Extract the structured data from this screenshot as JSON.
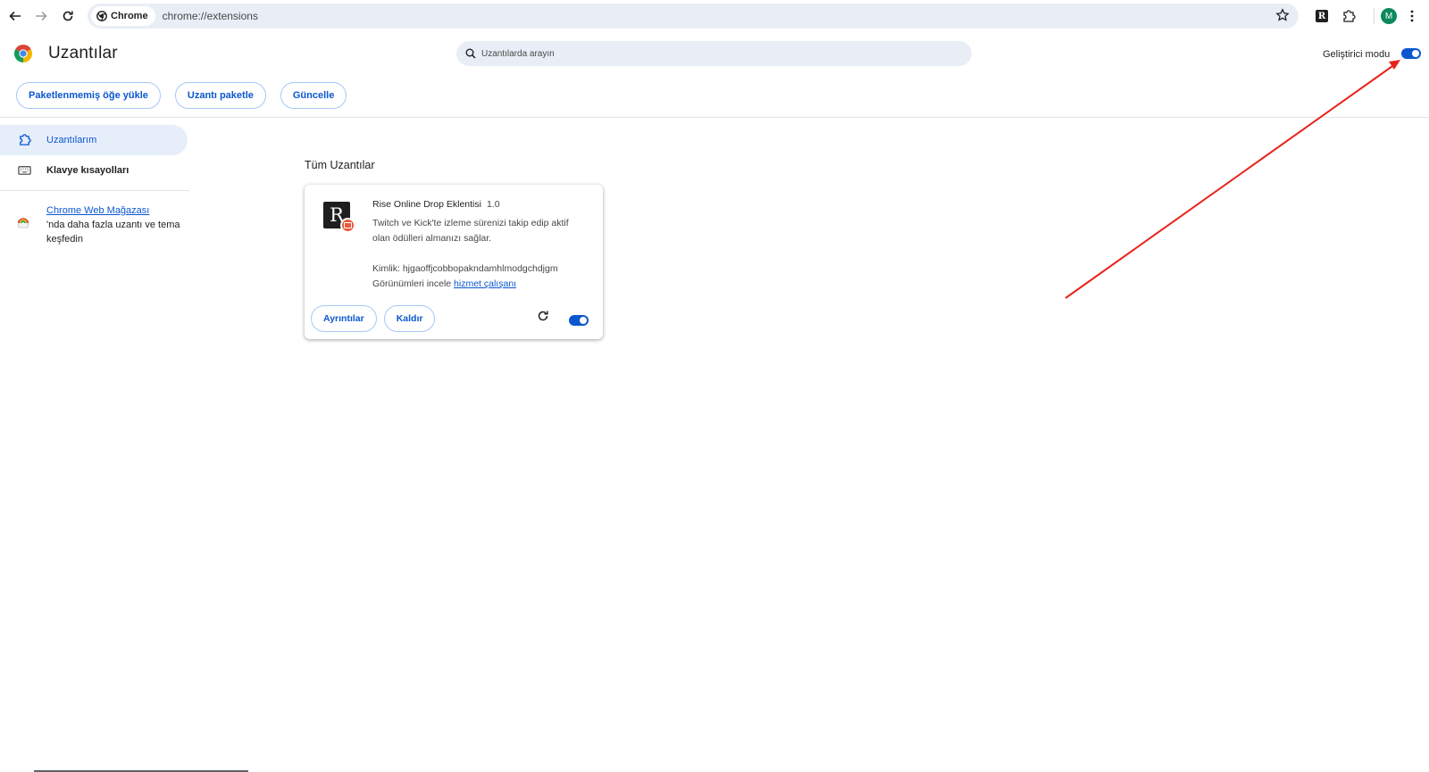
{
  "browser": {
    "chip_label": "Chrome",
    "url": "chrome://extensions",
    "avatar_initial": "M",
    "extension_badge": "R"
  },
  "header": {
    "title": "Uzantılar",
    "search_placeholder": "Uzantılarda arayın",
    "developer_mode_label": "Geliştirici modu",
    "developer_mode_on": true,
    "actions": [
      "Paketlenmemiş öğe yükle",
      "Uzantı paketle",
      "Güncelle"
    ]
  },
  "sidebar": {
    "items": [
      {
        "label": "Uzantılarım",
        "icon": "puzzle-icon",
        "active": true
      },
      {
        "label": "Klavye kısayolları",
        "icon": "keyboard-icon",
        "active": false
      }
    ],
    "store_link": "Chrome Web Mağazası",
    "store_text": "'nda daha fazla uzantı ve tema keşfedin"
  },
  "main": {
    "section_title": "Tüm Uzantılar",
    "extension": {
      "icon_letter": "R",
      "name": "Rise Online Drop Eklentisi",
      "version": "1.0",
      "description": "Twitch ve Kick'te izleme sürenizi takip edip aktif olan ödülleri almanızı sağlar.",
      "id_label": "Kimlik: hjgaoffjcobbopakndamhlmodgchdjgm",
      "views_label": "Görünümleri incele",
      "views_link": "hizmet çalışanı",
      "details_button": "Ayrıntılar",
      "remove_button": "Kaldır",
      "enabled": true
    }
  },
  "colors": {
    "accent": "#0b57d0",
    "annotation_arrow": "#e8231c"
  }
}
